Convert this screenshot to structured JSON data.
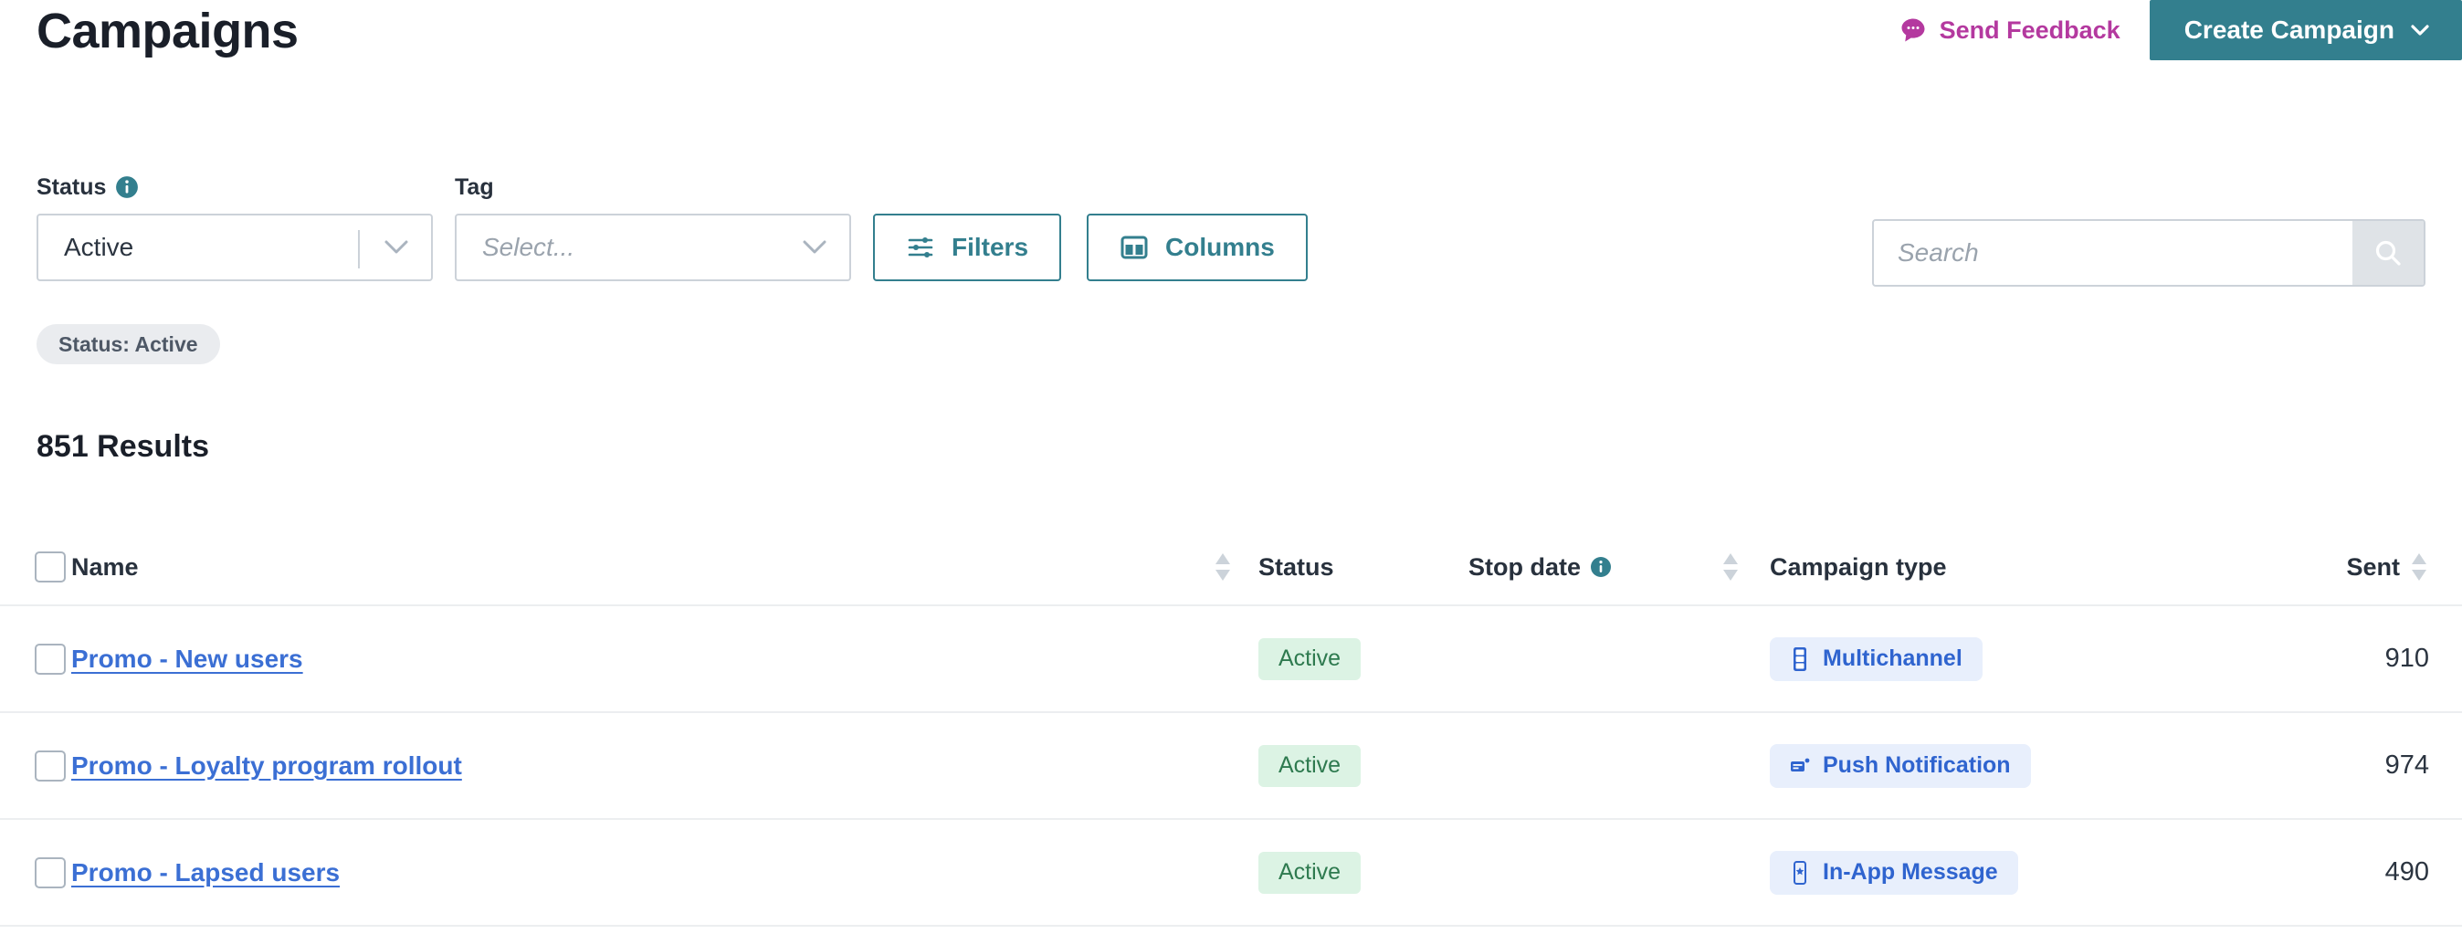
{
  "header": {
    "title": "Campaigns",
    "feedback_label": "Send Feedback",
    "feedback_icon": "speech-bubble-icon",
    "create_label": "Create Campaign",
    "create_caret_icon": "chevron-down-icon",
    "accent_teal": "#337f8e",
    "feedback_color": "#b4399f"
  },
  "filters": {
    "status": {
      "label": "Status",
      "info_icon": "info-icon",
      "value": "Active",
      "caret_icon": "chevron-down-icon"
    },
    "tag": {
      "label": "Tag",
      "placeholder": "Select...",
      "caret_icon": "chevron-down-icon"
    },
    "filters_button": {
      "label": "Filters",
      "icon": "tune-sliders-icon"
    },
    "columns_button": {
      "label": "Columns",
      "icon": "columns-layout-icon"
    },
    "search": {
      "placeholder": "Search",
      "value": "",
      "icon": "search-icon"
    },
    "active_chips": [
      {
        "label": "Status: Active"
      }
    ]
  },
  "results": {
    "count_label": "851 Results"
  },
  "table": {
    "columns": [
      {
        "key": "name",
        "label": "Name",
        "sortable": true
      },
      {
        "key": "status",
        "label": "Status",
        "sortable": false
      },
      {
        "key": "stop_date",
        "label": "Stop date",
        "sortable": true,
        "info_icon": "info-icon"
      },
      {
        "key": "campaign_type",
        "label": "Campaign type",
        "sortable": false
      },
      {
        "key": "sent",
        "label": "Sent",
        "sortable": true
      }
    ],
    "rows": [
      {
        "name": "Promo - New users",
        "status": "Active",
        "stop_date": "",
        "campaign_type": "Multichannel",
        "campaign_type_icon": "multichannel-icon",
        "sent": "910"
      },
      {
        "name": "Promo - Loyalty program rollout",
        "status": "Active",
        "stop_date": "",
        "campaign_type": "Push Notification",
        "campaign_type_icon": "push-notification-icon",
        "sent": "974"
      },
      {
        "name": "Promo - Lapsed users",
        "status": "Active",
        "stop_date": "",
        "campaign_type": "In-App Message",
        "campaign_type_icon": "in-app-message-icon",
        "sent": "490"
      }
    ]
  }
}
